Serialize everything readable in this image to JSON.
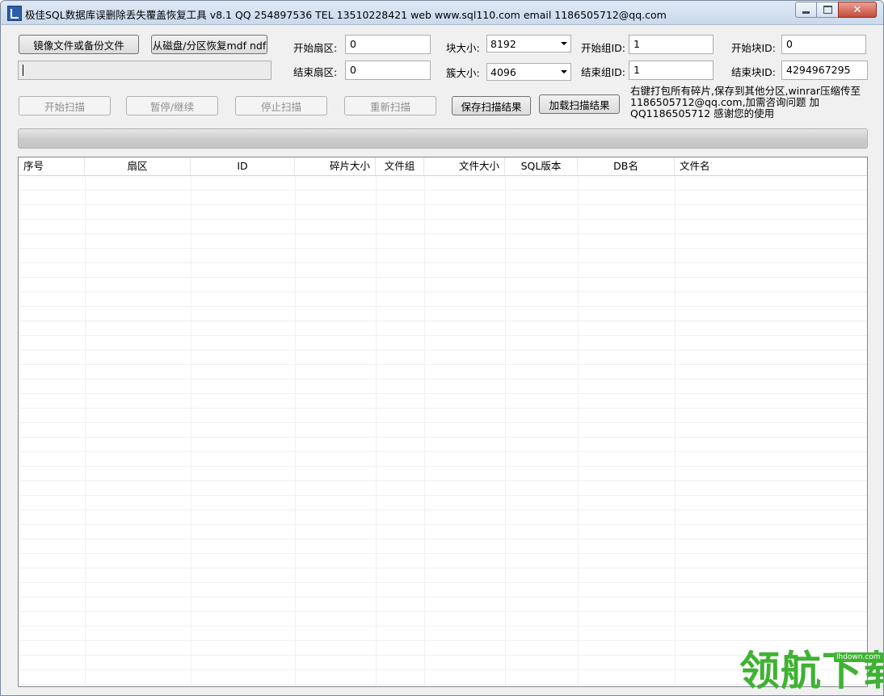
{
  "window": {
    "title": "极佳SQL数据库误删除丢失覆盖恢复工具 v8.1 QQ 254897536 TEL 13510228421 web www.sql110.com email 1186505712@qq.com"
  },
  "buttons": {
    "image_file": "镜像文件或备份文件",
    "recover_disk": "从磁盘/分区恢复mdf ndf",
    "start_scan": "开始扫描",
    "pause_continue": "暂停/继续",
    "stop_scan": "停止扫描",
    "rescan": "重新扫描",
    "save_results": "保存扫描结果",
    "load_results": "加载扫描结果"
  },
  "fields": {
    "start_sector": {
      "label": "开始扇区:",
      "value": "0"
    },
    "end_sector": {
      "label": "结束扇区:",
      "value": "0"
    },
    "block_size": {
      "label": "块大小:",
      "value": "8192"
    },
    "cluster_size": {
      "label": "簇大小:",
      "value": "4096"
    },
    "start_group_id": {
      "label": "开始组ID:",
      "value": "1"
    },
    "end_group_id": {
      "label": "结束组ID:",
      "value": "1"
    },
    "start_block_id": {
      "label": "开始块ID:",
      "value": "0"
    },
    "end_block_id": {
      "label": "结束块ID:",
      "value": "4294967295"
    }
  },
  "note": {
    "line1": "右键打包所有碎片,保存到其他分区,winrar压缩传至",
    "line2": "1186505712@qq.com,加需咨询问题 加",
    "line3": "QQ1186505712 感谢您的使用"
  },
  "progress": {
    "fraction": 0
  },
  "table": {
    "columns": [
      "序号",
      "扇区",
      "ID",
      "碎片大小",
      "文件组",
      "文件大小",
      "SQL版本",
      "DB名",
      "文件名"
    ]
  },
  "watermark": {
    "chars": "领航下载",
    "site": "lhdown.com"
  },
  "colors": {
    "watermark": "#3fb233",
    "progress_track": "#cdcdcd"
  }
}
